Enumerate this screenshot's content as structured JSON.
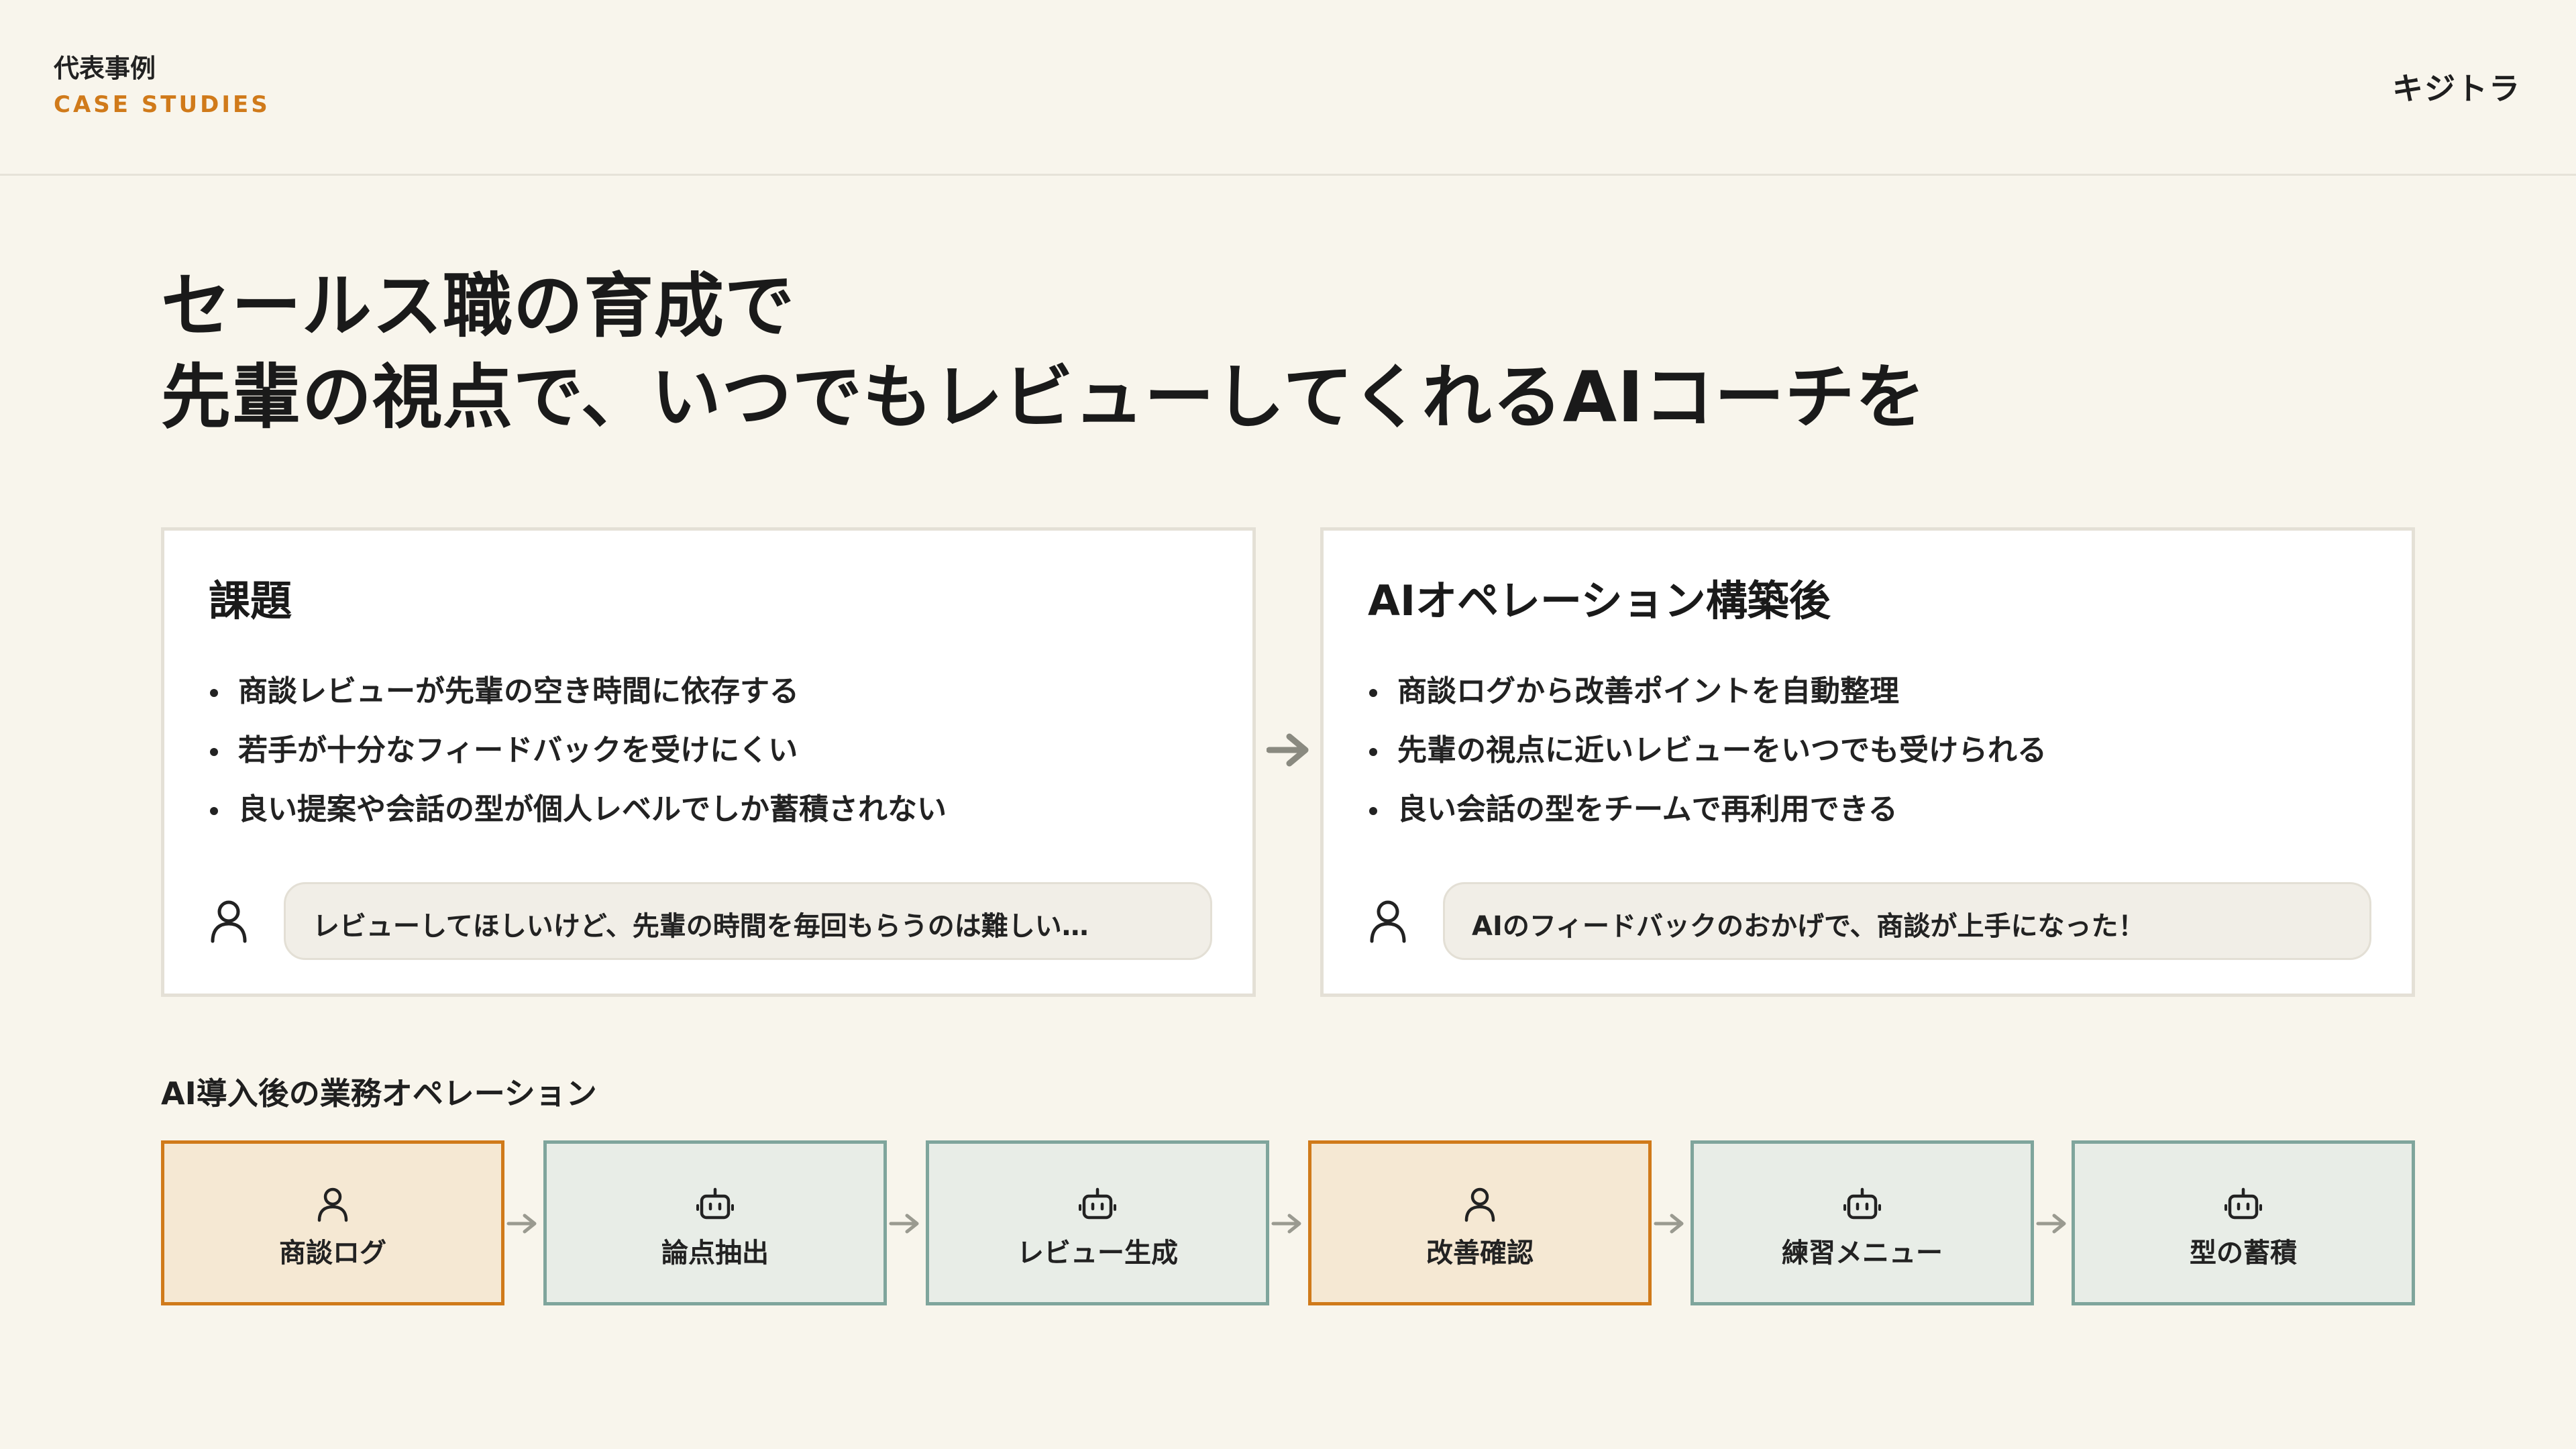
{
  "header": {
    "title_jp": "代表事例",
    "title_en": "CASE STUDIES",
    "brand": "キジトラ"
  },
  "headline": {
    "line1": "セールス職の育成で",
    "line2": "先輩の視点で、いつでもレビューしてくれるAIコーチを"
  },
  "before": {
    "title": "課題",
    "bullets": [
      "商談レビューが先輩の空き時間に依存する",
      "若手が十分なフィードバックを受けにくい",
      "良い提案や会話の型が個人レベルでしか蓄積されない"
    ],
    "quote": "レビューしてほしいけど、先輩の時間を毎回もらうのは難しい…"
  },
  "after": {
    "title": "AIオペレーション構築後",
    "bullets": [
      "商談ログから改善ポイントを自動整理",
      "先輩の視点に近いレビューをいつでも受けられる",
      "良い会話の型をチームで再利用できる"
    ],
    "quote": "AIのフィードバックのおかげで、商談が上手になった！"
  },
  "flow": {
    "title": "AI導入後の業務オペレーション",
    "steps": [
      {
        "label": "商談ログ",
        "actor": "human",
        "icon": "user-icon"
      },
      {
        "label": "論点抽出",
        "actor": "ai",
        "icon": "robot-icon"
      },
      {
        "label": "レビュー生成",
        "actor": "ai",
        "icon": "robot-icon"
      },
      {
        "label": "改善確認",
        "actor": "human",
        "icon": "user-icon"
      },
      {
        "label": "練習メニュー",
        "actor": "ai",
        "icon": "robot-icon"
      },
      {
        "label": "型の蓄積",
        "actor": "ai",
        "icon": "robot-icon"
      }
    ]
  },
  "colors": {
    "background": "#f8f5ec",
    "accent_orange": "#d07a1a",
    "human_fill": "#f5e8d3",
    "ai_border": "#7fa59c",
    "ai_fill": "#e8ede7",
    "arrow": "#9a9a90"
  }
}
